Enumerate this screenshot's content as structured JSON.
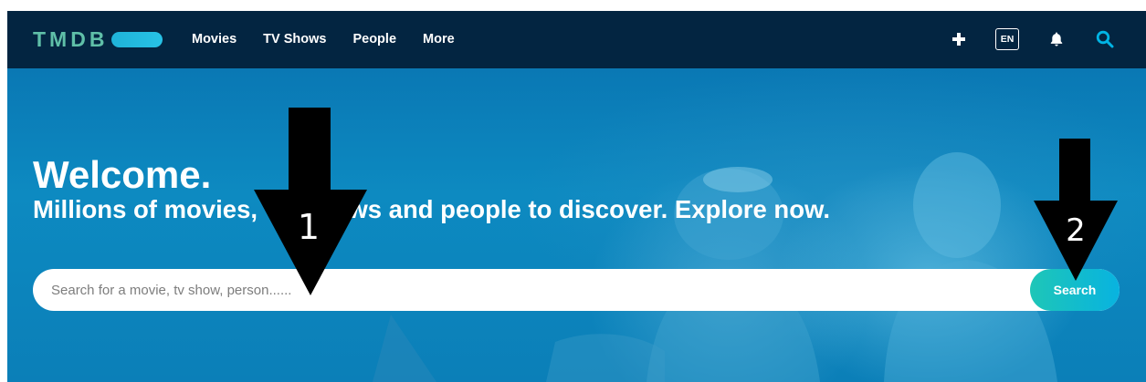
{
  "nav": {
    "logo_text": "TMDB",
    "links": [
      {
        "label": "Movies"
      },
      {
        "label": "TV Shows"
      },
      {
        "label": "People"
      },
      {
        "label": "More"
      }
    ],
    "language": "EN",
    "icons": [
      "plus-icon",
      "bell-icon",
      "search-icon"
    ],
    "background_color": "#032541",
    "logo_color": "#5fbfa8"
  },
  "hero": {
    "title": "Welcome.",
    "subtitle": "Millions of movies, TV shows and people to discover. Explore now.",
    "search": {
      "placeholder": "Search for a movie, tv show, person......",
      "value": "",
      "button_label": "Search"
    }
  },
  "annotations": [
    {
      "label": "1"
    },
    {
      "label": "2"
    }
  ],
  "colors": {
    "hero_blue": "#0b7fb8",
    "search_button_start": "#1ec6b7",
    "search_button_end": "#08b3e0"
  }
}
